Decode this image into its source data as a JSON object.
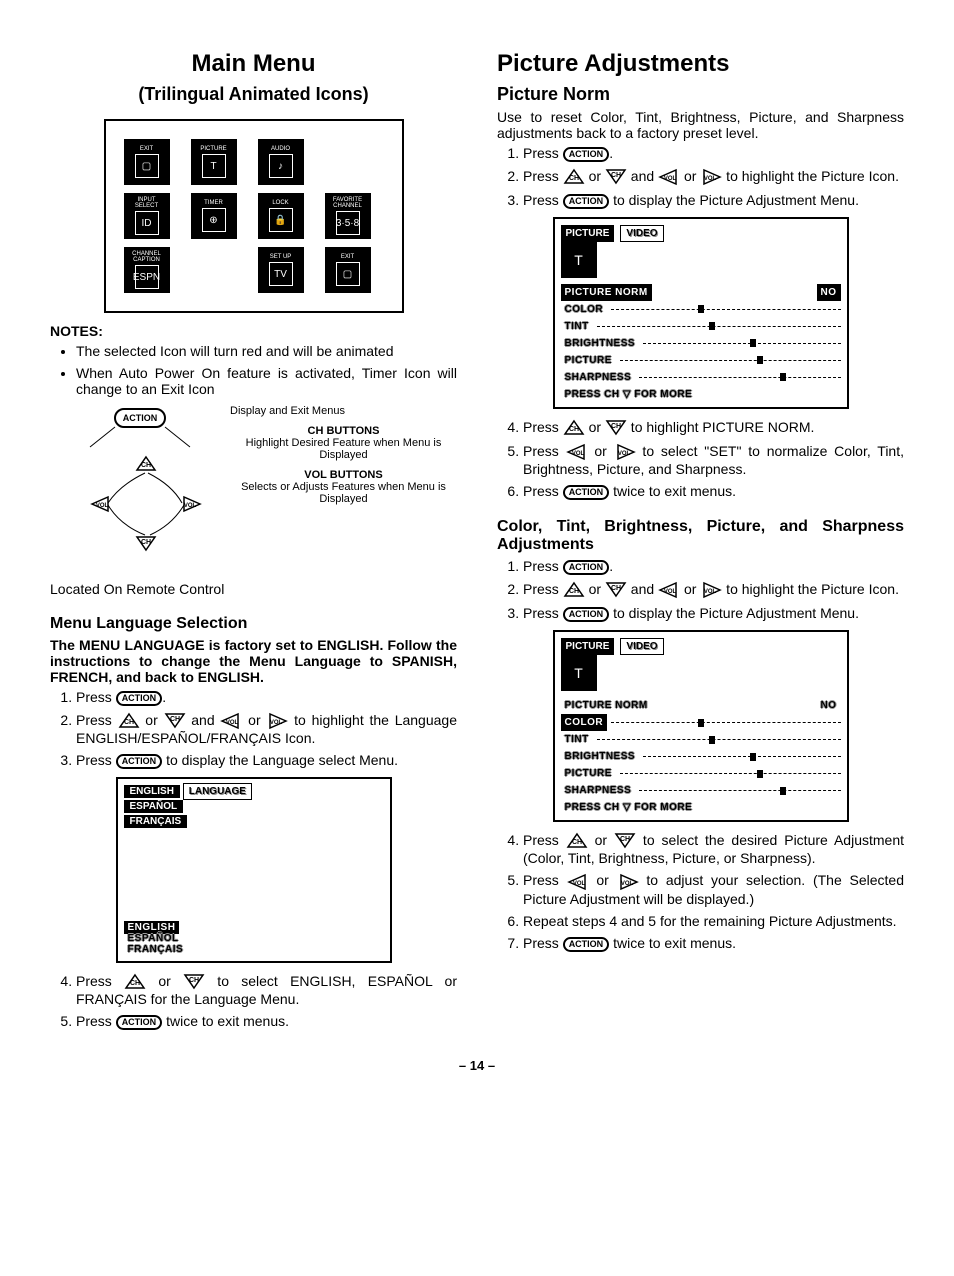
{
  "left": {
    "title": "Main Menu",
    "subtitle": "(Trilingual Animated Icons)",
    "icons": [
      "EXIT",
      "PICTURE",
      "AUDIO",
      "",
      "INPUT SELECT",
      "TIMER",
      "LOCK",
      "FAVORITE CHANNEL",
      "CHANNEL CAPTION",
      "",
      "SET UP",
      "EXIT"
    ],
    "icon_glyphs": [
      "▢",
      "T",
      "♪",
      "",
      "ID",
      "⊕",
      "🔒",
      "3·5·8",
      "ESPN",
      "",
      "TV",
      "▢"
    ],
    "notes_label": "NOTES:",
    "notes": [
      "The selected Icon will turn red and will be animated",
      "When Auto Power On feature is activated, Timer Icon will change to an Exit Icon"
    ],
    "action_label": "ACTION",
    "display_exit": "Display and Exit Menus",
    "ch_buttons_head": "CH BUTTONS",
    "ch_buttons_body": "Highlight Desired Feature when Menu is Displayed",
    "vol_buttons_head": "VOL BUTTONS",
    "vol_buttons_body": "Selects or Adjusts Features when Menu is Displayed",
    "located": "Located On Remote Control",
    "menu_lang_title": "Menu Language Selection",
    "menu_lang_intro": "The MENU LANGUAGE is factory set to ENGLISH. Follow the instructions to change the Menu Language to SPANISH, FRENCH, and back to ENGLISH.",
    "lang_steps": {
      "s1": "Press ",
      "s1b": ".",
      "s2a": "Press ",
      "s2b": " or ",
      "s2c": " and ",
      "s2d": " or ",
      "s2e": " to highlight the Language ENGLISH/ESPAÑOL/FRANÇAIS Icon.",
      "s3a": "Press ",
      "s3b": " to display the Language select Menu.",
      "s4a": "Press ",
      "s4b": " or ",
      "s4c": " to select ENGLISH, ESPAÑOL or FRANÇAIS for the Language Menu.",
      "s5a": "Press ",
      "s5b": " twice to exit menus."
    },
    "lang_osd": {
      "header": "LANGUAGE",
      "top": [
        "ENGLISH",
        "ESPAÑOL",
        "FRANÇAIS"
      ],
      "bottom": [
        "ENGLISH",
        "ESPAÑOL",
        "FRANÇAIS"
      ]
    }
  },
  "right": {
    "title": "Picture Adjustments",
    "norm_title": "Picture Norm",
    "norm_intro": "Use to reset Color, Tint, Brightness, Picture, and Sharpness adjustments back to a factory preset level.",
    "norm_steps": {
      "s1a": "Press ",
      "s1b": ".",
      "s2a": "Press ",
      "s2b": " or ",
      "s2c": " and ",
      "s2d": " or ",
      "s2e": " to highlight the Picture Icon.",
      "s3a": "Press ",
      "s3b": " to display the Picture Adjustment Menu.",
      "s4a": "Press ",
      "s4b": " or ",
      "s4c": " to highlight PICTURE NORM.",
      "s5a": "Press ",
      "s5b": " or ",
      "s5c": " to select \"SET\" to normalize Color, Tint, Brightness, Picture, and Sharpness.",
      "s6a": "Press ",
      "s6b": " twice to exit menus."
    },
    "osd": {
      "picture": "PICTURE",
      "video": "VIDEO",
      "rows": [
        "PICTURE NORM",
        "COLOR",
        "TINT",
        "BRIGHTNESS",
        "PICTURE",
        "SHARPNESS"
      ],
      "no": "NO",
      "footer": "PRESS CH ▽ FOR MORE"
    },
    "adjust_title": "Color, Tint, Brightness, Picture, and Sharpness Adjustments",
    "adjust_steps": {
      "s1a": "Press ",
      "s1b": ".",
      "s2a": "Press ",
      "s2b": " or ",
      "s2c": " and ",
      "s2d": " or ",
      "s2e": " to highlight the Picture Icon.",
      "s3a": "Press ",
      "s3b": " to display the Picture Adjustment Menu.",
      "s4a": "Press ",
      "s4b": " or ",
      "s4c": " to select the desired Picture Adjustment (Color, Tint, Brightness, Picture, or Sharpness).",
      "s5a": "Press ",
      "s5b": " or ",
      "s5c": " to adjust your selection. (The Selected Picture Adjustment will be displayed.)",
      "s6": "Repeat steps 4 and 5 for the remaining Picture Adjustments.",
      "s7a": "Press ",
      "s7b": " twice to exit menus."
    }
  },
  "page_num": "– 14 –"
}
